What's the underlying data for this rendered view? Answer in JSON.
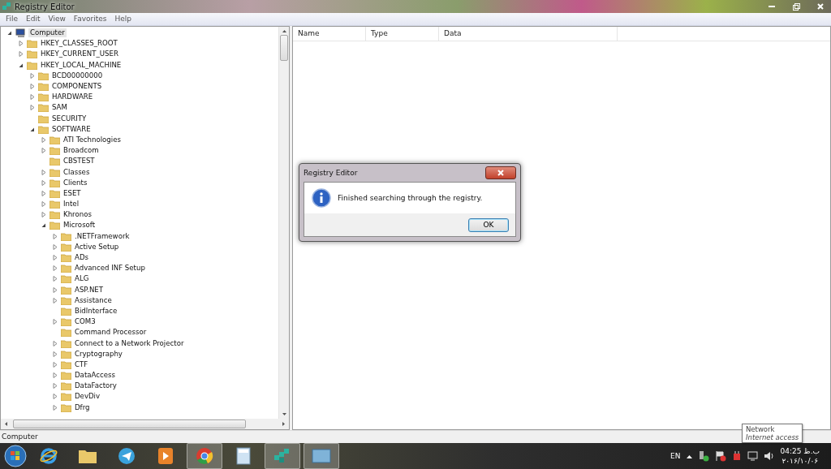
{
  "window": {
    "title": "Registry Editor"
  },
  "menu": [
    "File",
    "Edit",
    "View",
    "Favorites",
    "Help"
  ],
  "tree": [
    {
      "label": "Computer",
      "kind": "computer",
      "expanded": true,
      "selected": true,
      "children": [
        {
          "label": "HKEY_CLASSES_ROOT",
          "kind": "branch",
          "expanded": false
        },
        {
          "label": "HKEY_CURRENT_USER",
          "kind": "branch",
          "expanded": false
        },
        {
          "label": "HKEY_LOCAL_MACHINE",
          "kind": "branch",
          "expanded": true,
          "children": [
            {
              "label": "BCD00000000",
              "kind": "branch",
              "expanded": false
            },
            {
              "label": "COMPONENTS",
              "kind": "branch",
              "expanded": false
            },
            {
              "label": "HARDWARE",
              "kind": "branch",
              "expanded": false
            },
            {
              "label": "SAM",
              "kind": "branch",
              "expanded": false
            },
            {
              "label": "SECURITY",
              "kind": "leaf"
            },
            {
              "label": "SOFTWARE",
              "kind": "branch",
              "expanded": true,
              "children": [
                {
                  "label": "ATI Technologies",
                  "kind": "branch",
                  "expanded": false
                },
                {
                  "label": "Broadcom",
                  "kind": "branch",
                  "expanded": false
                },
                {
                  "label": "CBSTEST",
                  "kind": "leaf"
                },
                {
                  "label": "Classes",
                  "kind": "branch",
                  "expanded": false
                },
                {
                  "label": "Clients",
                  "kind": "branch",
                  "expanded": false
                },
                {
                  "label": "ESET",
                  "kind": "branch",
                  "expanded": false
                },
                {
                  "label": "Intel",
                  "kind": "branch",
                  "expanded": false
                },
                {
                  "label": "Khronos",
                  "kind": "branch",
                  "expanded": false
                },
                {
                  "label": "Microsoft",
                  "kind": "branch",
                  "expanded": true,
                  "children": [
                    {
                      "label": ".NETFramework",
                      "kind": "branch",
                      "expanded": false
                    },
                    {
                      "label": "Active Setup",
                      "kind": "branch",
                      "expanded": false
                    },
                    {
                      "label": "ADs",
                      "kind": "branch",
                      "expanded": false
                    },
                    {
                      "label": "Advanced INF Setup",
                      "kind": "branch",
                      "expanded": false
                    },
                    {
                      "label": "ALG",
                      "kind": "branch",
                      "expanded": false
                    },
                    {
                      "label": "ASP.NET",
                      "kind": "branch",
                      "expanded": false
                    },
                    {
                      "label": "Assistance",
                      "kind": "branch",
                      "expanded": false
                    },
                    {
                      "label": "BidInterface",
                      "kind": "leaf"
                    },
                    {
                      "label": "COM3",
                      "kind": "branch",
                      "expanded": false
                    },
                    {
                      "label": "Command Processor",
                      "kind": "leaf"
                    },
                    {
                      "label": "Connect to a Network Projector",
                      "kind": "branch",
                      "expanded": false
                    },
                    {
                      "label": "Cryptography",
                      "kind": "branch",
                      "expanded": false
                    },
                    {
                      "label": "CTF",
                      "kind": "branch",
                      "expanded": false
                    },
                    {
                      "label": "DataAccess",
                      "kind": "branch",
                      "expanded": false
                    },
                    {
                      "label": "DataFactory",
                      "kind": "branch",
                      "expanded": false
                    },
                    {
                      "label": "DevDiv",
                      "kind": "branch",
                      "expanded": false
                    },
                    {
                      "label": "Dfrg",
                      "kind": "branch",
                      "expanded": false
                    }
                  ]
                }
              ]
            }
          ]
        }
      ]
    }
  ],
  "columns": [
    "Name",
    "Type",
    "Data"
  ],
  "status_bar": "Computer",
  "dialog": {
    "title": "Registry Editor",
    "message": "Finished searching through the registry.",
    "button": "OK"
  },
  "tooltip": {
    "title": "Network",
    "subtitle": "Internet access"
  },
  "taskbar": {
    "apps": [
      {
        "kind": "ie",
        "active": false
      },
      {
        "kind": "folder",
        "active": false
      },
      {
        "kind": "telegram",
        "active": false
      },
      {
        "kind": "media",
        "active": false
      },
      {
        "kind": "chrome",
        "active": true
      },
      {
        "kind": "calculator",
        "active": false
      },
      {
        "kind": "regedit",
        "active": true
      },
      {
        "kind": "picture",
        "active": true
      }
    ],
    "language": "EN",
    "time": "04:25 ب.ظ",
    "date": "۲۰۱۶/۱۰/۰۶"
  }
}
